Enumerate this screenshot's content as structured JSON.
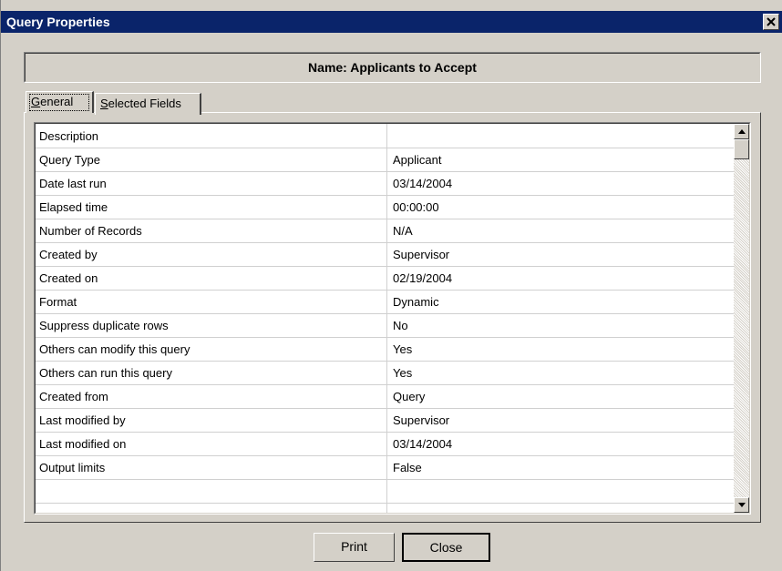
{
  "window": {
    "title": "Query Properties",
    "close_glyph": "close-icon"
  },
  "name_bar": {
    "text": "Name:  Applicants to Accept"
  },
  "tabs": [
    {
      "label": "General",
      "hotkey": "G",
      "rest": "eneral",
      "active": true
    },
    {
      "label": "Selected Fields",
      "hotkey": "S",
      "rest": "elected Fields",
      "active": false
    }
  ],
  "properties": [
    {
      "name": "Description",
      "value": ""
    },
    {
      "name": "Query Type",
      "value": "Applicant"
    },
    {
      "name": "Date last run",
      "value": "03/14/2004"
    },
    {
      "name": "Elapsed time",
      "value": "00:00:00"
    },
    {
      "name": "Number of Records",
      "value": "N/A"
    },
    {
      "name": "Created by",
      "value": "Supervisor"
    },
    {
      "name": "Created on",
      "value": "02/19/2004"
    },
    {
      "name": "Format",
      "value": "Dynamic"
    },
    {
      "name": "Suppress duplicate rows",
      "value": "No"
    },
    {
      "name": "Others can modify this query",
      "value": "Yes"
    },
    {
      "name": "Others can run this query",
      "value": "Yes"
    },
    {
      "name": "Created from",
      "value": "Query"
    },
    {
      "name": "Last modified by",
      "value": "Supervisor"
    },
    {
      "name": "Last modified on",
      "value": "03/14/2004"
    },
    {
      "name": "Output limits",
      "value": "False"
    }
  ],
  "buttons": {
    "print": "Print",
    "close": "Close"
  },
  "colors": {
    "titlebar": "#0a246a",
    "face": "#d4d0c8"
  }
}
